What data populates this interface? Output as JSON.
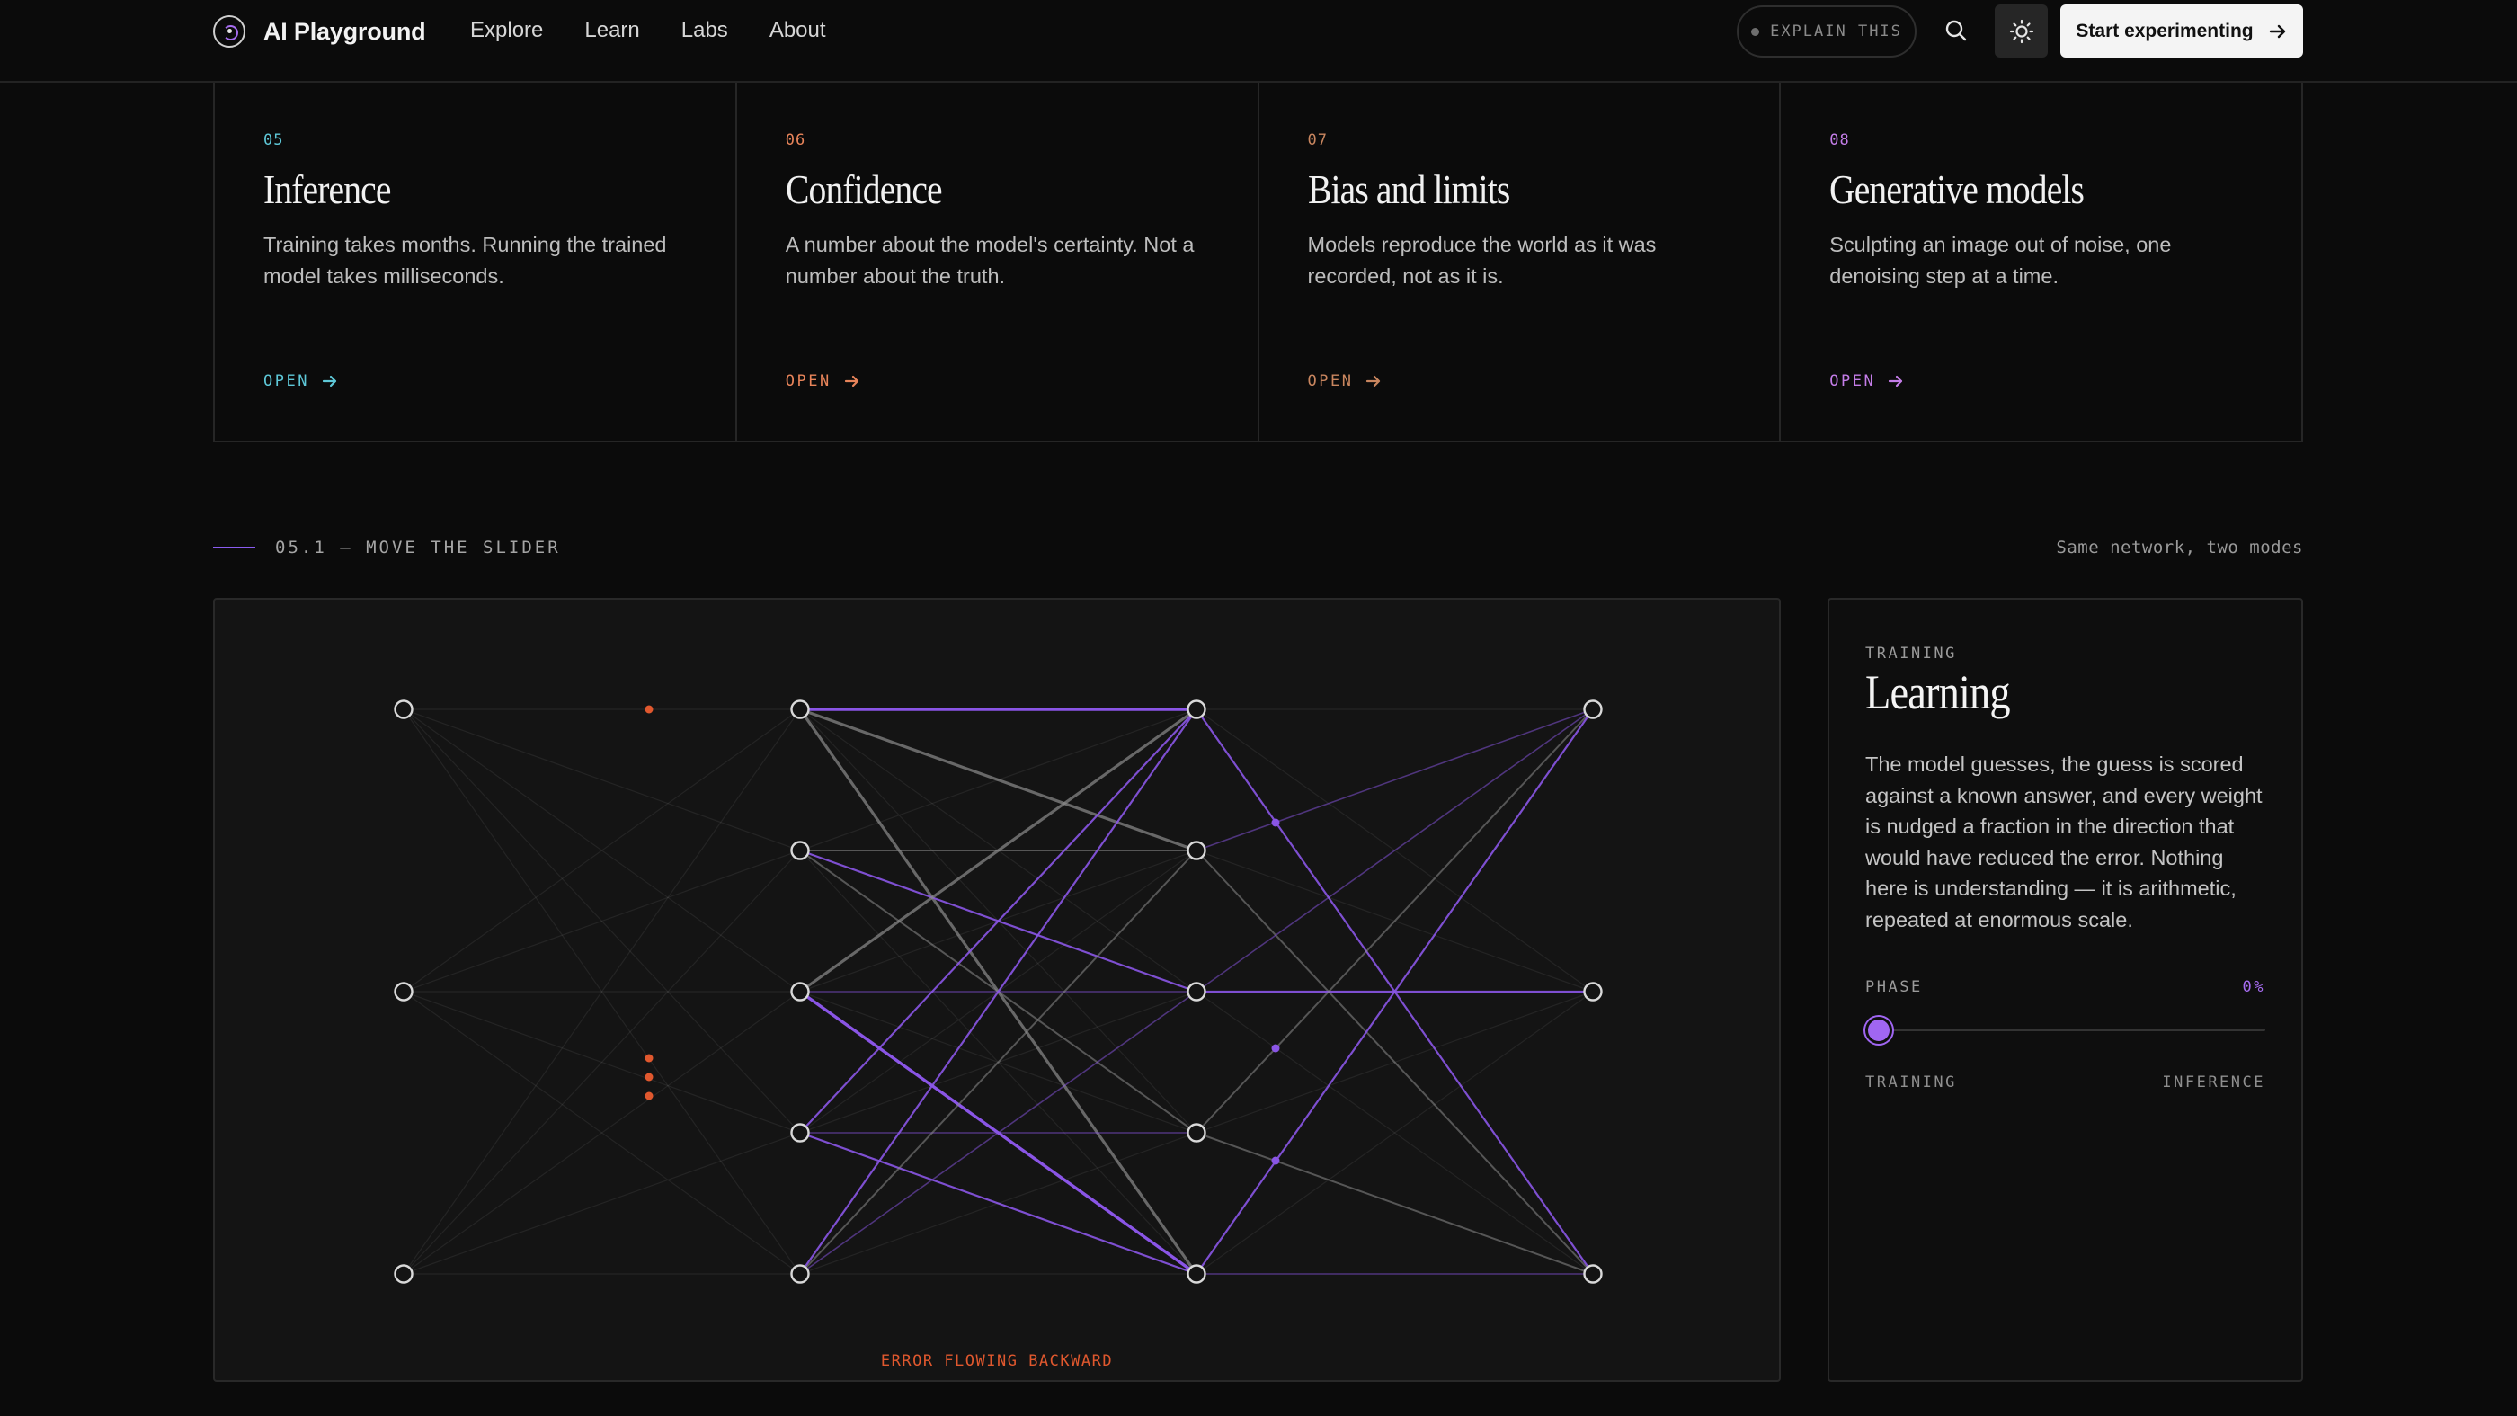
{
  "header": {
    "brand": "AI Playground",
    "nav": [
      "Explore",
      "Learn",
      "Labs",
      "About"
    ],
    "explain_label": "EXPLAIN THIS",
    "cta_label": "Start experimenting"
  },
  "cards": [
    {
      "num": "05",
      "title": "Inference",
      "desc": "Training takes months. Running the trained model takes milliseconds.",
      "open": "OPEN",
      "color": "#5ec8d8"
    },
    {
      "num": "06",
      "title": "Confidence",
      "desc": "A number about the model's certainty. Not a number about the truth.",
      "open": "OPEN",
      "color": "#e8845a"
    },
    {
      "num": "07",
      "title": "Bias and limits",
      "desc": "Models reproduce the world as it was recorded, not as it is.",
      "open": "OPEN",
      "color": "#c9865f"
    },
    {
      "num": "08",
      "title": "Generative models",
      "desc": "Sculpting an image out of noise, one denoising step at a time.",
      "open": "OPEN",
      "color": "#c47de8"
    }
  ],
  "section": {
    "label": "05.1 — MOVE THE SLIDER",
    "right": "Same network, two modes"
  },
  "network": {
    "layers": [
      3,
      5,
      5,
      3
    ],
    "error_label": "ERROR FLOWING BACKWARD",
    "accent": "#8a55e6",
    "error_color": "#e0582e"
  },
  "side": {
    "kicker": "TRAINING",
    "title": "Learning",
    "desc": "The model guesses, the guess is scored against a known answer, and every weight is nudged a fraction in the direction that would have reduced the error. Nothing here is understanding — it is arithmetic, repeated at enormous scale.",
    "phase_label": "PHASE",
    "phase_value": "0%",
    "phase": 0,
    "left_end": "TRAINING",
    "right_end": "INFERENCE"
  }
}
